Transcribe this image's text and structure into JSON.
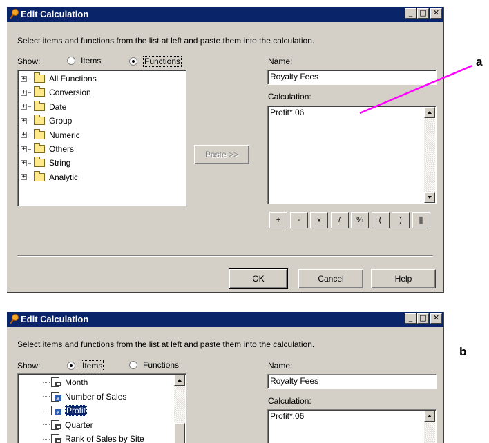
{
  "callouts": {
    "a": "a",
    "b": "b"
  },
  "dialog_a": {
    "title": "Edit Calculation",
    "window_buttons": {
      "minimize": "_",
      "maximize": "□",
      "close": "✕"
    },
    "instruction": "Select items and functions from the list at left and paste them into the calculation.",
    "show_label": "Show:",
    "radio_items": "Items",
    "radio_functions": "Functions",
    "selected_radio": "Functions",
    "tree": [
      "All Functions",
      "Conversion",
      "Date",
      "Group",
      "Numeric",
      "Others",
      "String",
      "Analytic"
    ],
    "paste_button": "Paste >>",
    "name_label": "Name:",
    "name_value": "Royalty Fees",
    "calculation_label": "Calculation:",
    "calculation_value": "Profit*.06",
    "operators": [
      "+",
      "-",
      "x",
      "/",
      "%",
      "(",
      ")",
      "||"
    ],
    "ok_button": "OK",
    "cancel_button": "Cancel",
    "help_button": "Help"
  },
  "dialog_b": {
    "title": "Edit Calculation",
    "window_buttons": {
      "minimize": "_",
      "maximize": "□",
      "close": "✕"
    },
    "instruction": "Select items and functions from the list at left and paste them into the calculation.",
    "show_label": "Show:",
    "radio_items": "Items",
    "radio_functions": "Functions",
    "selected_radio": "Items",
    "tree": [
      "Month",
      "Number of Sales",
      "Profit",
      "Quarter",
      "Rank of Sales by Site"
    ],
    "selected_tree_item": "Profit",
    "name_label": "Name:",
    "name_value": "Royalty Fees",
    "calculation_label": "Calculation:",
    "calculation_value": "Profit*.06"
  },
  "colors": {
    "titlebar": "#0a246a",
    "dialog_face": "#d4d0c8",
    "callout_line": "#ff00ff"
  }
}
